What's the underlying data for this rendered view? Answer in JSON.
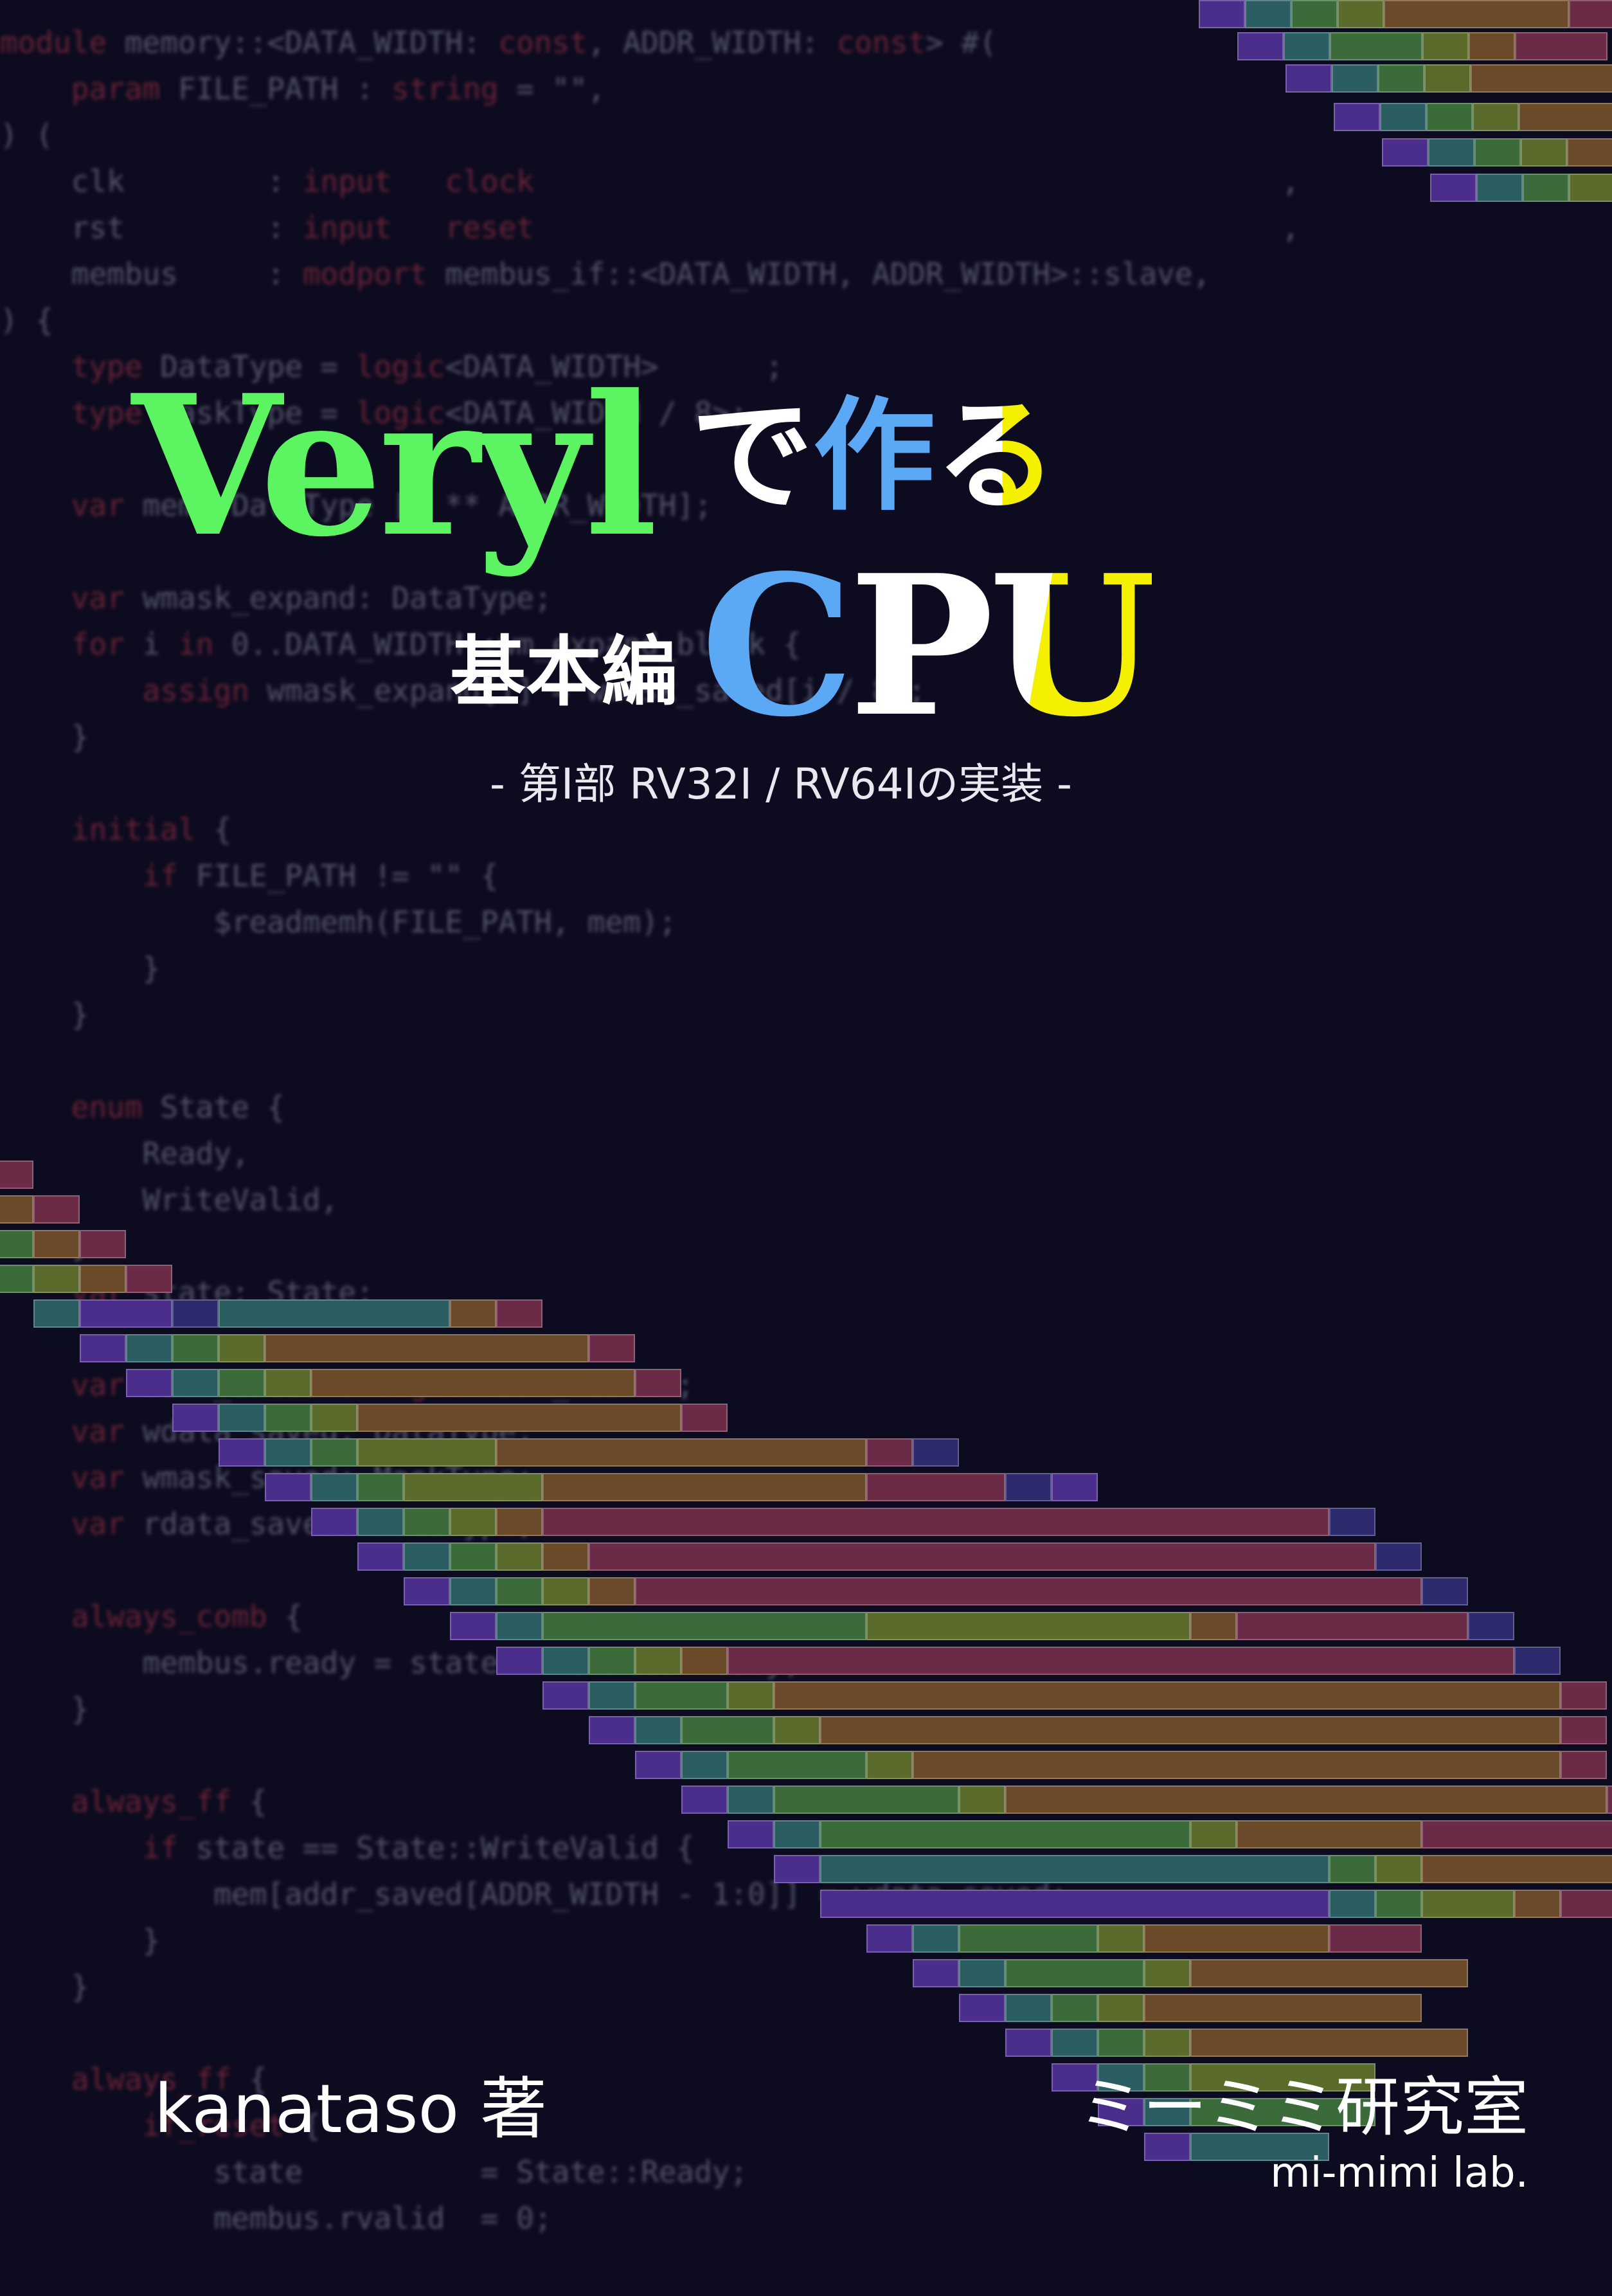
{
  "cover": {
    "title_main": "Veryl",
    "title_tsukuru_1": "で",
    "title_tsukuru_2": "作",
    "title_tsukuru_3": "る",
    "title_series": "基本編",
    "title_cpu_c": "C",
    "title_cpu_p": "P",
    "title_cpu_u": "U",
    "subtitle": "- 第I部 RV32I / RV64Iの実装 -",
    "author": "kanataso 著",
    "publisher_ja": "ミーミミ研究室",
    "publisher_en": "mi-mimi lab."
  },
  "colors": {
    "background": "#0d0b1f",
    "veryl_green": "#5cf561",
    "accent_blue": "#5ba8f5",
    "accent_yellow": "#f5f000",
    "seg_purple": "#4b2d8c",
    "seg_indigo": "#2d2a6e",
    "seg_teal": "#2b5e63",
    "seg_green": "#3b6b3a",
    "seg_olive": "#5a6b2c",
    "seg_brown": "#6b4a2a",
    "seg_maroon": "#6b2a45"
  },
  "background_code": [
    "module memory::<DATA_WIDTH: const, ADDR_WIDTH: const> #(",
    "    param FILE_PATH : string = \"\",",
    ") (",
    "    clk        : input   clock                                          ,",
    "    rst        : input   reset                                          ,",
    "    membus     : modport membus_if::<DATA_WIDTH, ADDR_WIDTH>::slave,",
    ") {",
    "    type DataType = logic<DATA_WIDTH>      ;",
    "    type MaskType = logic<DATA_WIDTH / 8>;",
    "",
    "    var mem: DataType [2 ** ADDR_WIDTH];",
    "",
    "    var wmask_expand: DataType;",
    "    for i in 0..DATA_WIDTH :wm_expand_block {",
    "        assign wmask_expand[i] = wmask_saved[i / 8];",
    "    }",
    "",
    "    initial {",
    "        if FILE_PATH != \"\" {",
    "            $readmemh(FILE_PATH, mem);",
    "        }",
    "    }",
    "",
    "    enum State {",
    "        Ready,",
    "        WriteValid,",
    "    }",
    "    var state: State;",
    "",
    "    var addr_saved : logic<ADDR_WIDTH>;",
    "    var wdata_saved: DataType;",
    "    var wmask_saved: MaskType;",
    "    var rdata_saved: DataType;",
    "",
    "    always_comb {",
    "        membus.ready = state == State::Ready;",
    "    }",
    "",
    "    always_ff {",
    "        if state == State::WriteValid {",
    "            mem[addr_saved[ADDR_WIDTH - 1:0]] = wdata_saved;",
    "        }",
    "    }",
    "",
    "    always_ff {",
    "        if_reset {",
    "            state          = State::Ready;",
    "            membus.rvalid  = 0;"
  ]
}
